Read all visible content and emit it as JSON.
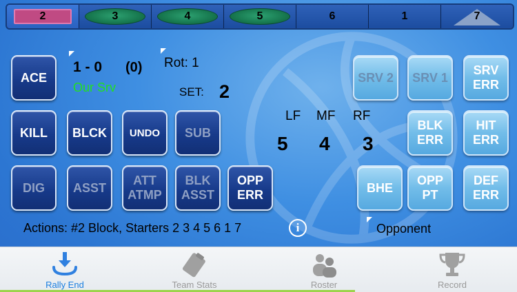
{
  "lineup": {
    "slots": [
      "2",
      "3",
      "4",
      "5",
      "6",
      "1",
      "7"
    ]
  },
  "buttons": {
    "ace": "ACE",
    "kill": "KILL",
    "blck": "BLCK",
    "undo": "UNDO",
    "sub": "SUB",
    "dig": "DIG",
    "asst": "ASST",
    "att_atmp": "ATT\nATMP",
    "blk_asst": "BLK\nASST",
    "opp_err": "OPP\nERR",
    "srv2": "SRV 2",
    "srv1": "SRV 1",
    "srv_err": "SRV\nERR",
    "blk_err": "BLK\nERR",
    "hit_err": "HIT\nERR",
    "bhe": "BHE",
    "opp_pt": "OPP\nPT",
    "def_err": "DEF\nERR"
  },
  "score": {
    "value": "1 - 0",
    "sets": "(0)",
    "serve_status": "Our Srv",
    "rotation": "Rot: 1",
    "set_label": "SET:",
    "set_number": "2"
  },
  "front_row": {
    "headers": [
      "LF",
      "MF",
      "RF"
    ],
    "players": [
      "5",
      "4",
      "3"
    ]
  },
  "actions_text": "Actions: #2 Block, Starters 2 3 4 5 6 1 7",
  "info_glyph": "i",
  "opponent_label": "Opponent",
  "tabs": [
    {
      "label": "Rally End",
      "icon": "rally-end-icon"
    },
    {
      "label": "Team Stats",
      "icon": "clipboard-icon"
    },
    {
      "label": "Roster",
      "icon": "people-icon"
    },
    {
      "label": "Record",
      "icon": "trophy-icon"
    }
  ],
  "colors": {
    "serve_status": "#21e021",
    "tab_active": "#1b7fe0"
  }
}
